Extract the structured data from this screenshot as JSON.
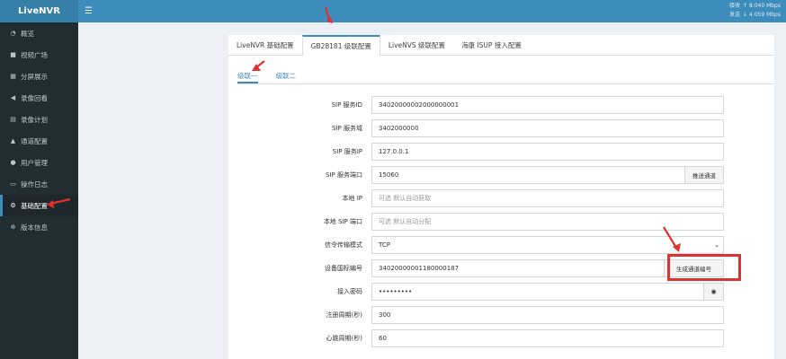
{
  "app": {
    "name": "LiveNVR",
    "menu_icon": "hamburger-icon"
  },
  "net": {
    "recv_label": "接收",
    "recv_value": "8.040 Mbps",
    "send_label": "发送",
    "send_value": "4.059 Mbps"
  },
  "sidebar": {
    "items": [
      {
        "label": "概览",
        "icon": "dashboard-icon"
      },
      {
        "label": "视频广场",
        "icon": "video-icon"
      },
      {
        "label": "分屏展示",
        "icon": "grid-icon"
      },
      {
        "label": "录像回看",
        "icon": "rewind-icon"
      },
      {
        "label": "录像计划",
        "icon": "calendar-icon"
      },
      {
        "label": "通道配置",
        "icon": "channel-icon"
      },
      {
        "label": "用户管理",
        "icon": "users-icon"
      },
      {
        "label": "操作日志",
        "icon": "log-icon"
      },
      {
        "label": "基础配置",
        "icon": "gears-icon"
      },
      {
        "label": "版本信息",
        "icon": "info-icon"
      }
    ]
  },
  "tabs": [
    "LiveNVR 基础配置",
    "GB28181 级联配置",
    "LiveNVS 级联配置",
    "海康 ISUP 接入配置"
  ],
  "subtabs": [
    "级联一",
    "级联二"
  ],
  "form": {
    "sip_id": {
      "label": "SIP 服务ID",
      "value": "34020000002000000001"
    },
    "sip_domain": {
      "label": "SIP 服务域",
      "value": "3402000000"
    },
    "sip_ip": {
      "label": "SIP 服务IP",
      "value": "127.0.0.1"
    },
    "sip_port": {
      "label": "SIP 服务端口",
      "value": "15060",
      "button": "推送通道"
    },
    "local_ip": {
      "label": "本地 IP",
      "placeholder": "可选 默认自动获取"
    },
    "local_sip_port": {
      "label": "本地 SIP 端口",
      "placeholder": "可选 默认自动分配"
    },
    "transport": {
      "label": "信令传输模式",
      "value": "TCP"
    },
    "device_id": {
      "label": "设备国标编号",
      "value": "34020000001180000187",
      "button": "生成通道编号"
    },
    "password": {
      "label": "接入密码",
      "value": "•••••••••"
    },
    "register_period": {
      "label": "注册周期(秒)",
      "value": "300"
    },
    "heartbeat_period": {
      "label": "心跳周期(秒)",
      "value": "60"
    }
  },
  "colors": {
    "brand": "#3c8dbc",
    "sidebar": "#222d32",
    "highlight": "#e03131"
  }
}
